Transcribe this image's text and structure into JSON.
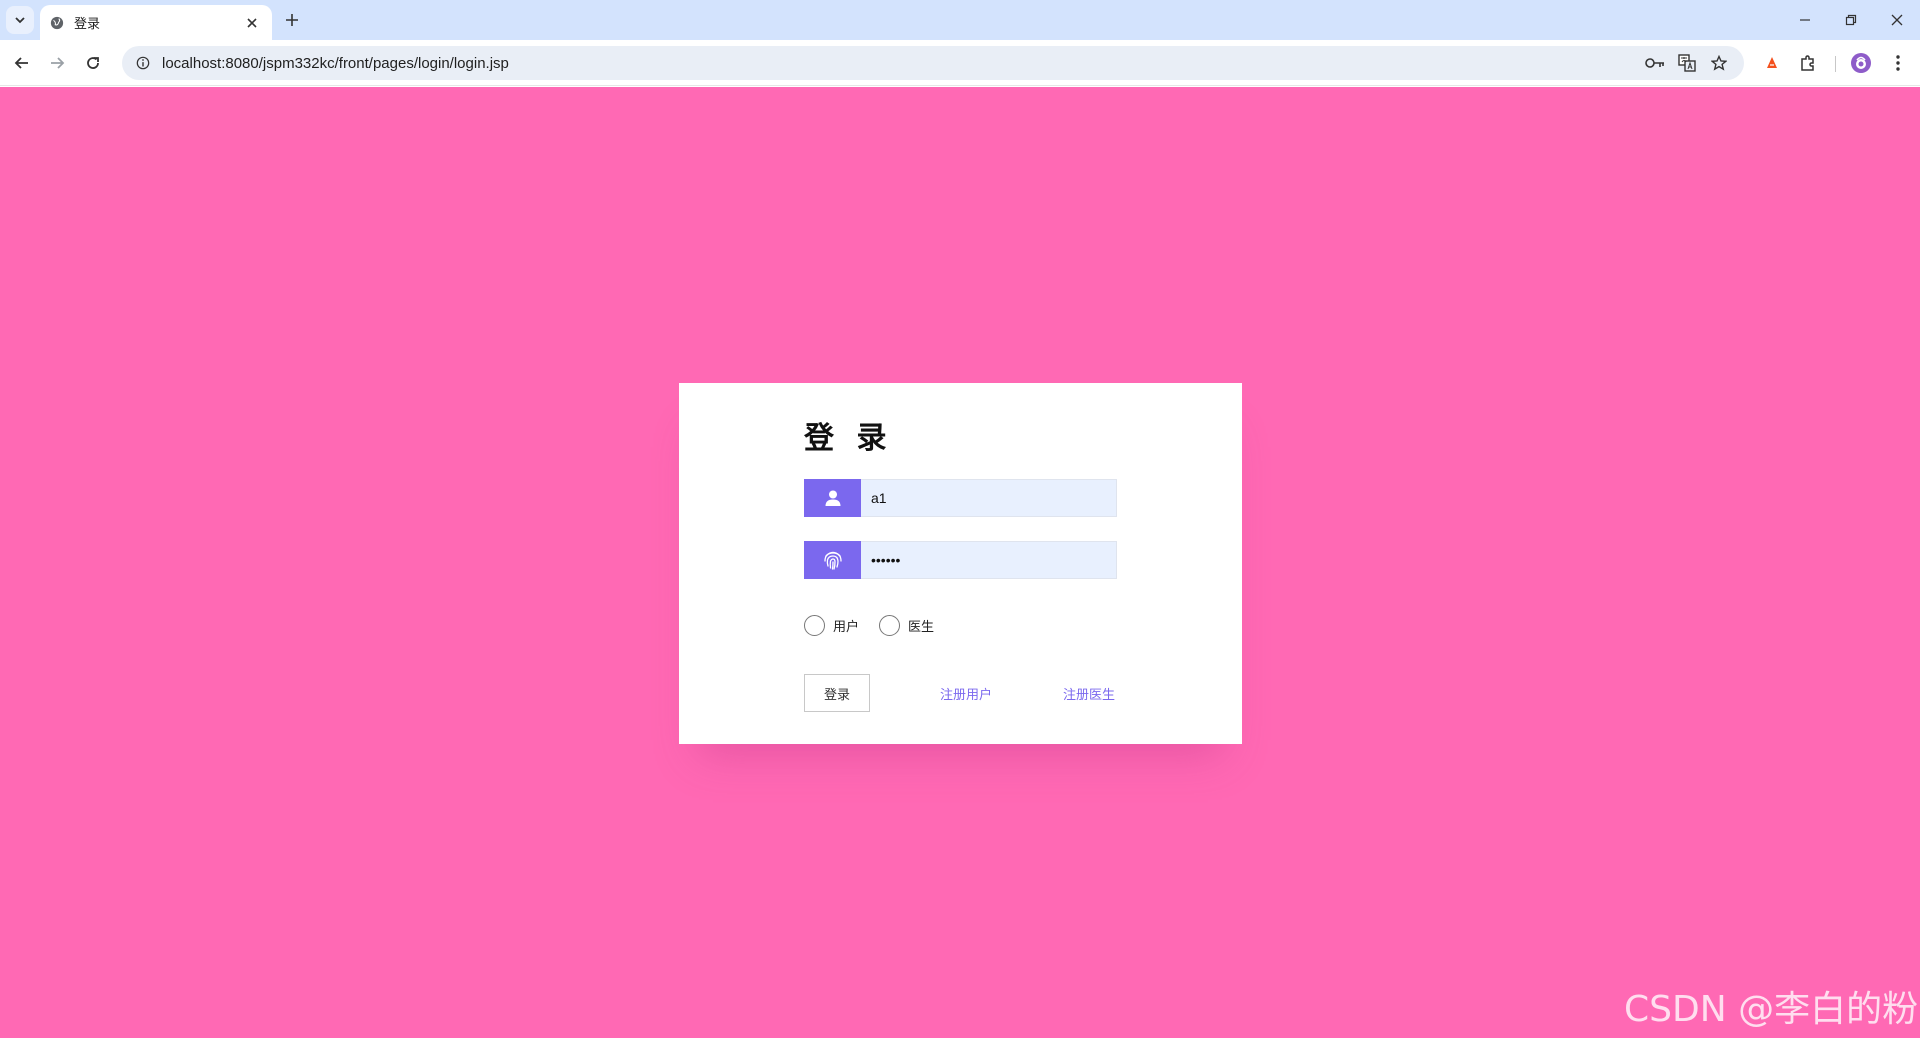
{
  "browser": {
    "tab": {
      "title": "登录"
    },
    "address_bar": {
      "url": "localhost:8080/jspm332kc/front/pages/login/login.jsp"
    }
  },
  "login": {
    "title": "登 录",
    "username": {
      "value": "a1"
    },
    "password": {
      "value": "••••••"
    },
    "roles": [
      {
        "label": "用户"
      },
      {
        "label": "医生"
      }
    ],
    "login_button": "登录",
    "register_user_link": "注册用户",
    "register_doctor_link": "注册医生"
  },
  "watermark": "CSDN @李白的粉",
  "colors": {
    "page_background": "#ff69b4",
    "accent": "#7b68ee",
    "input_background": "#e8f0fe"
  }
}
